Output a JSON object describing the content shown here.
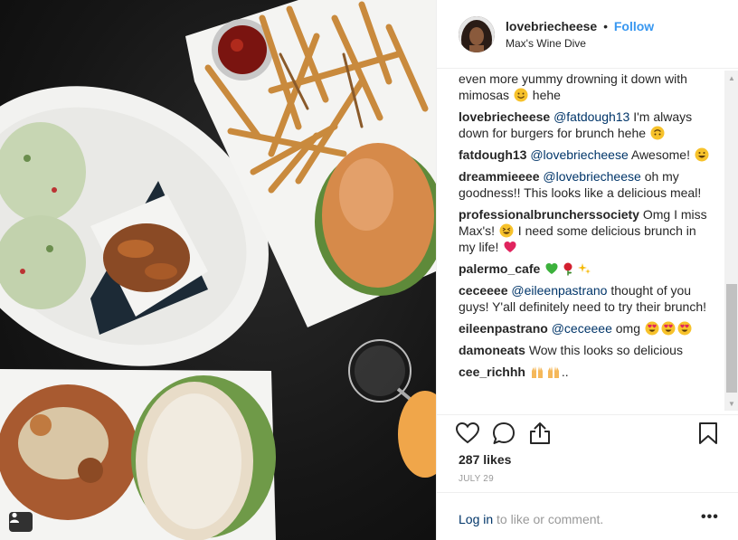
{
  "post": {
    "username": "lovebriecheese",
    "separator": "•",
    "follow_label": "Follow",
    "location": "Max's Wine Dive"
  },
  "comments": [
    {
      "user": "",
      "mention": "",
      "text": "even more yummy drowning it down with mimosas",
      "trail": "hehe",
      "emoji": [
        "smile"
      ]
    },
    {
      "user": "lovebriecheese",
      "mention": "@fatdough13",
      "text": "I'm always down for burgers for brunch hehe",
      "trail": "",
      "emoji": [
        "upside-down"
      ]
    },
    {
      "user": "fatdough13",
      "mention": "@lovebriecheese",
      "text": "Awesome!",
      "trail": "",
      "emoji": [
        "grin"
      ]
    },
    {
      "user": "dreammieeee",
      "mention": "@lovebriecheese",
      "text": "oh my goodness!! This looks like a delicious meal!",
      "trail": "",
      "emoji": []
    },
    {
      "user": "professionalbruncherssociety",
      "mention": "",
      "text": "Omg I miss Max's!",
      "trail": "I need some delicious brunch in my life!",
      "emoji": [
        "grin-squint",
        "heart"
      ]
    },
    {
      "user": "palermo_cafe",
      "mention": "",
      "text": "",
      "trail": "",
      "emoji": [
        "green-heart",
        "rose",
        "sparkles"
      ]
    },
    {
      "user": "ceceeee",
      "mention": "@eileenpastrano",
      "text": "thought of you guys! Y'all definitely need to try their brunch!",
      "trail": "",
      "emoji": []
    },
    {
      "user": "eileenpastrano",
      "mention": "@ceceeee",
      "text": "omg",
      "trail": "",
      "emoji": [
        "heart-eyes",
        "heart-eyes",
        "heart-eyes"
      ]
    },
    {
      "user": "damoneats",
      "mention": "",
      "text": "Wow this looks so delicious",
      "trail": "",
      "emoji": []
    },
    {
      "user": "cee_richhh",
      "mention": "",
      "text": "..",
      "trail": "",
      "emoji": [
        "raised-hands",
        "raised-hands"
      ]
    }
  ],
  "likes": "287 likes",
  "date": "JULY 29",
  "login": {
    "link": "Log in",
    "rest": "to like or comment."
  },
  "more_label": "•••",
  "icons": [
    "heart-icon",
    "comment-icon",
    "share-icon",
    "bookmark-icon",
    "tag-user-icon",
    "more-icon"
  ],
  "colors": {
    "link": "#003569",
    "follow": "#3897f0",
    "muted": "#999999"
  }
}
